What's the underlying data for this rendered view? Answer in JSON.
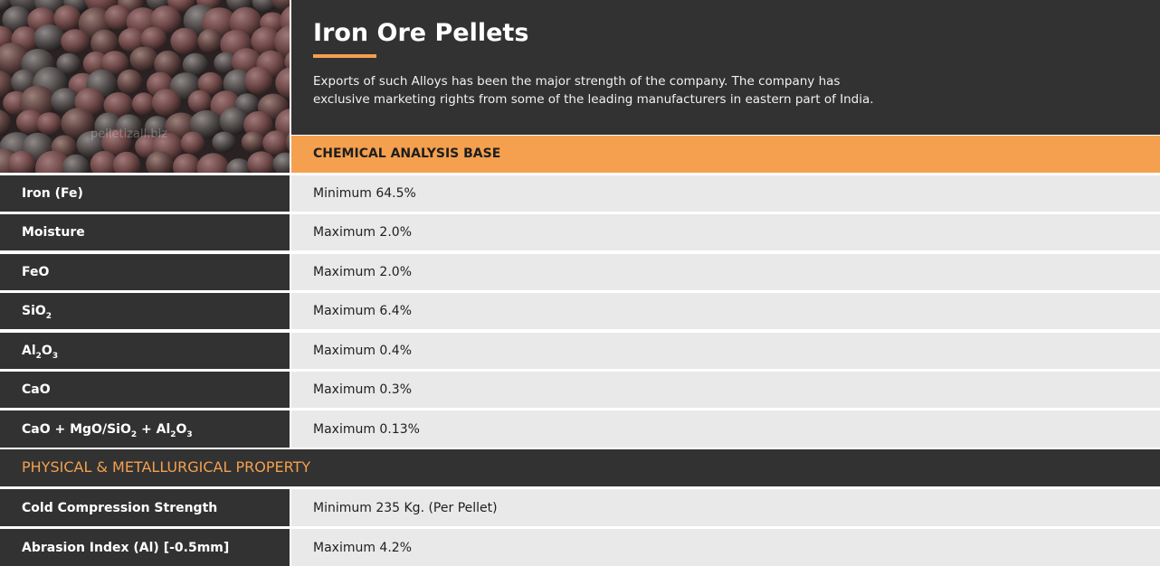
{
  "header": {
    "title": "Iron Ore Pellets",
    "description": "Exports of such Alloys has been the major strength of the company. The company has exclusive marketing rights from some of the leading manufacturers in eastern part of India.",
    "image_watermark": "pelletizall.biz"
  },
  "chemical_section": {
    "heading": "CHEMICAL ANALYSIS BASE",
    "rows": [
      {
        "label": "Iron (Fe)",
        "value": "Minimum 64.5%"
      },
      {
        "label": "Moisture",
        "value": "Maximum 2.0%"
      },
      {
        "label": "FeO",
        "value": "Maximum 2.0%"
      },
      {
        "label_parts": [
          "SiO",
          "2"
        ],
        "value": "Maximum 6.4%"
      },
      {
        "label_parts": [
          "Al",
          "2",
          "O",
          "3"
        ],
        "value": "Maximum 0.4%"
      },
      {
        "label": "CaO",
        "value": "Maximum 0.3%"
      },
      {
        "label_parts": [
          "CaO + MgO/SiO",
          "2",
          " + Al",
          "2",
          "O",
          "3"
        ],
        "value": "Maximum 0.13%"
      }
    ]
  },
  "physical_section": {
    "heading": "PHYSICAL & METALLURGICAL PROPERTY",
    "rows": [
      {
        "label": "Cold Compression Strength",
        "value": "Minimum 235 Kg. (Per Pellet)"
      },
      {
        "label": "Abrasion Index (Al) [-0.5mm]",
        "value": "Maximum 4.2%"
      }
    ]
  },
  "colors": {
    "dark": "#323232",
    "accent": "#f4a04e",
    "value_bg": "#e9e9e9"
  }
}
